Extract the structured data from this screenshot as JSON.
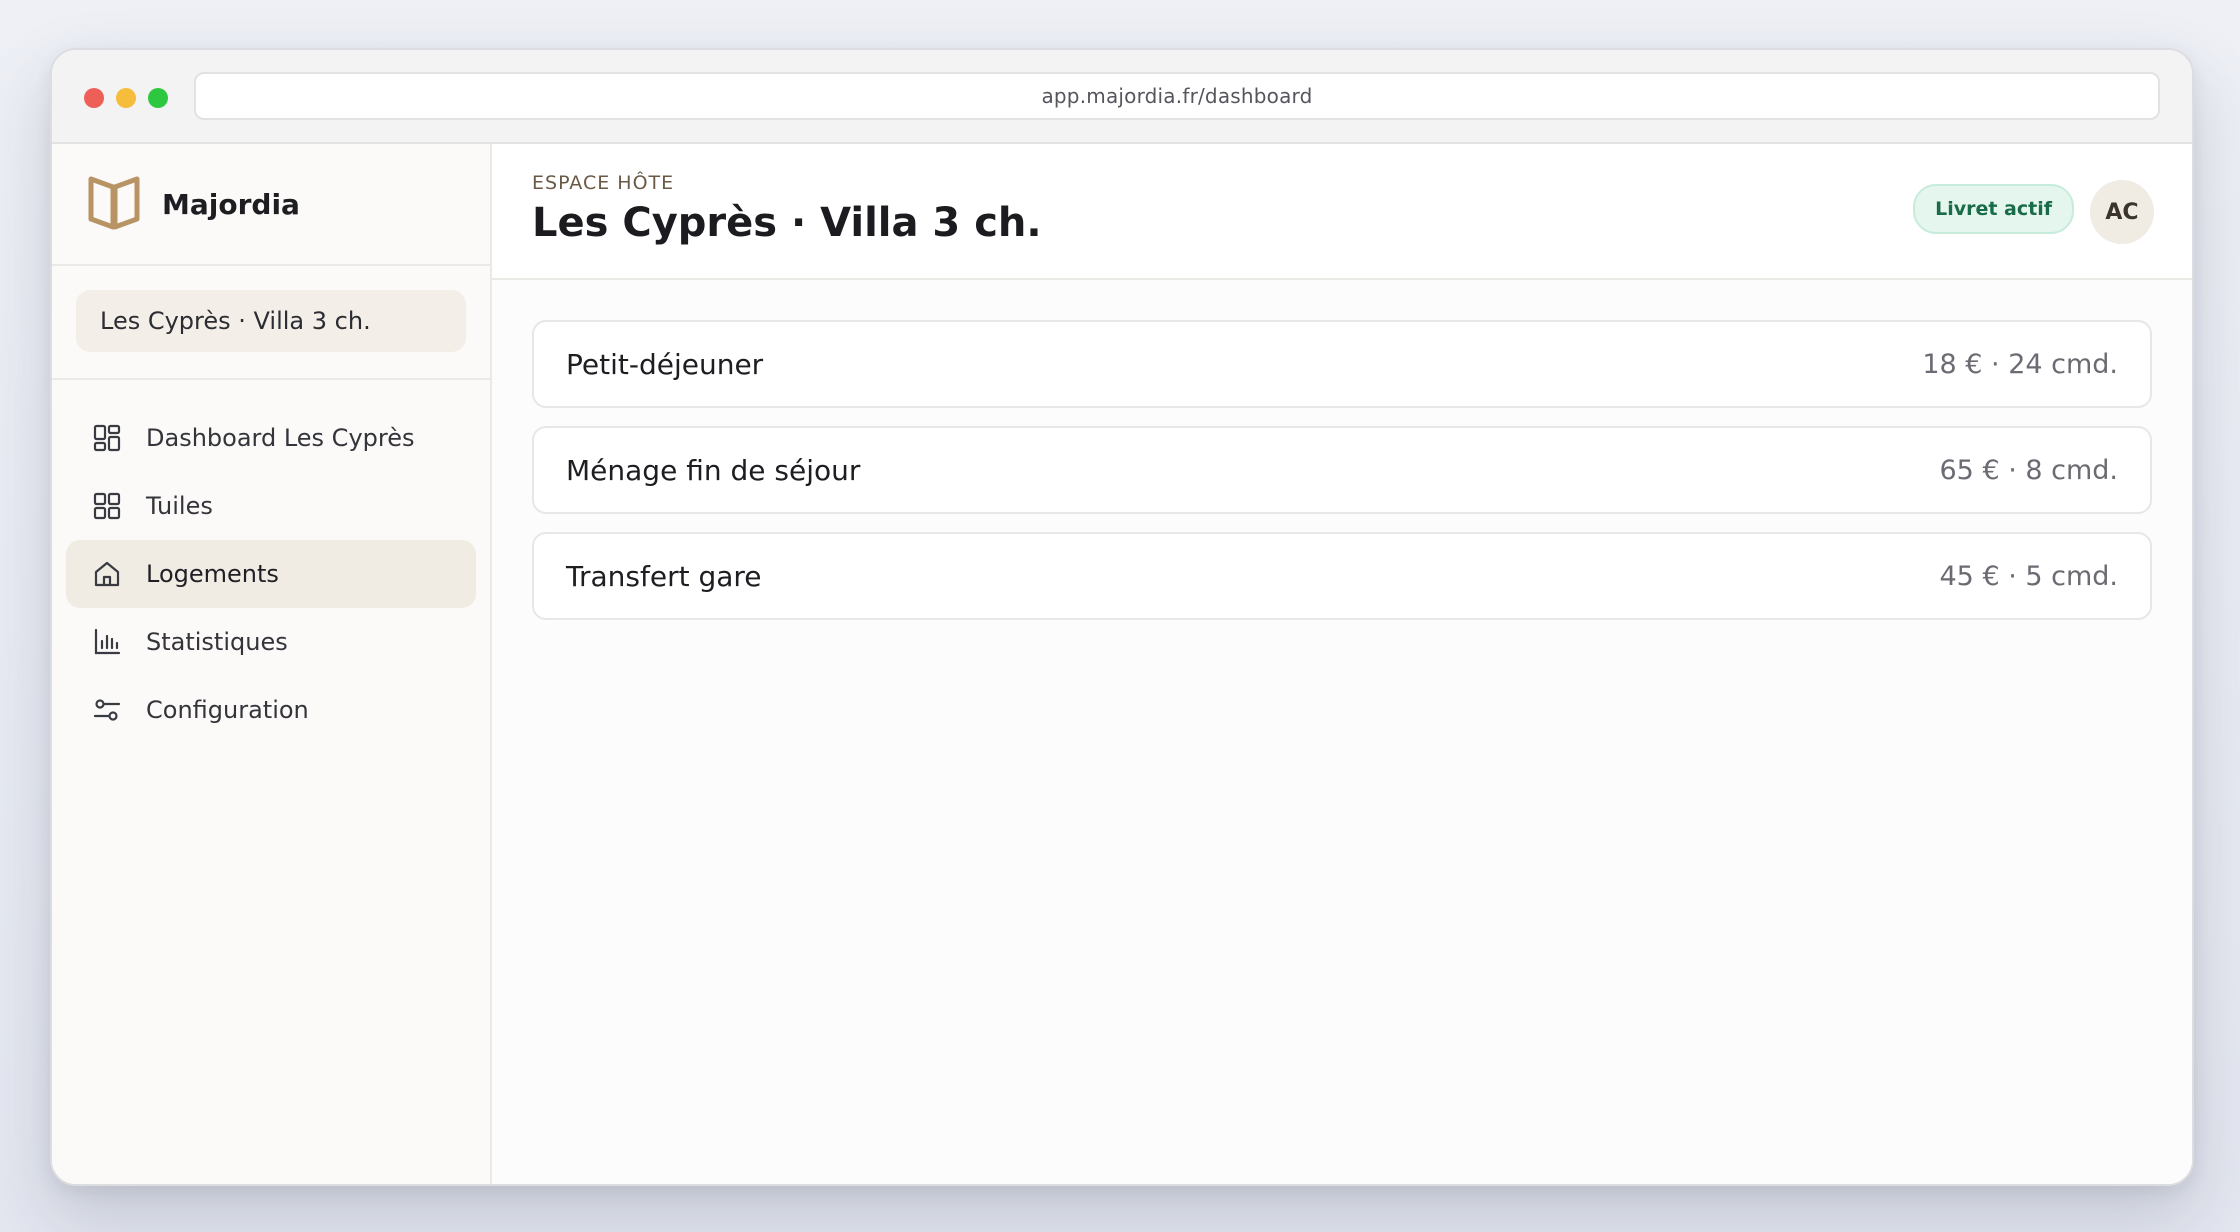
{
  "browser": {
    "url": "app.majordia.fr/dashboard"
  },
  "brand": {
    "name": "Majordia"
  },
  "sidebar": {
    "property": "Les Cyprès · Villa 3 ch.",
    "items": [
      {
        "label": "Dashboard Les Cyprès",
        "icon": "dashboard-icon",
        "active": false
      },
      {
        "label": "Tuiles",
        "icon": "grid-icon",
        "active": false
      },
      {
        "label": "Logements",
        "icon": "home-icon",
        "active": true
      },
      {
        "label": "Statistiques",
        "icon": "bar-chart-icon",
        "active": false
      },
      {
        "label": "Configuration",
        "icon": "sliders-icon",
        "active": false
      }
    ]
  },
  "header": {
    "kicker": "ESPACE HÔTE",
    "title": "Les Cyprès · Villa 3 ch.",
    "badge": "Livret actif",
    "avatar": "AC"
  },
  "services": [
    {
      "name": "Petit-déjeuner",
      "meta": "18 € · 24 cmd."
    },
    {
      "name": "Ménage fin de séjour",
      "meta": "65 € · 8 cmd."
    },
    {
      "name": "Transfert gare",
      "meta": "45 € · 5 cmd."
    }
  ],
  "colors": {
    "accent": "#b89464",
    "active_bg": "#f0ebe3",
    "badge_bg": "#e4f6ee",
    "badge_text": "#1a6b47"
  }
}
